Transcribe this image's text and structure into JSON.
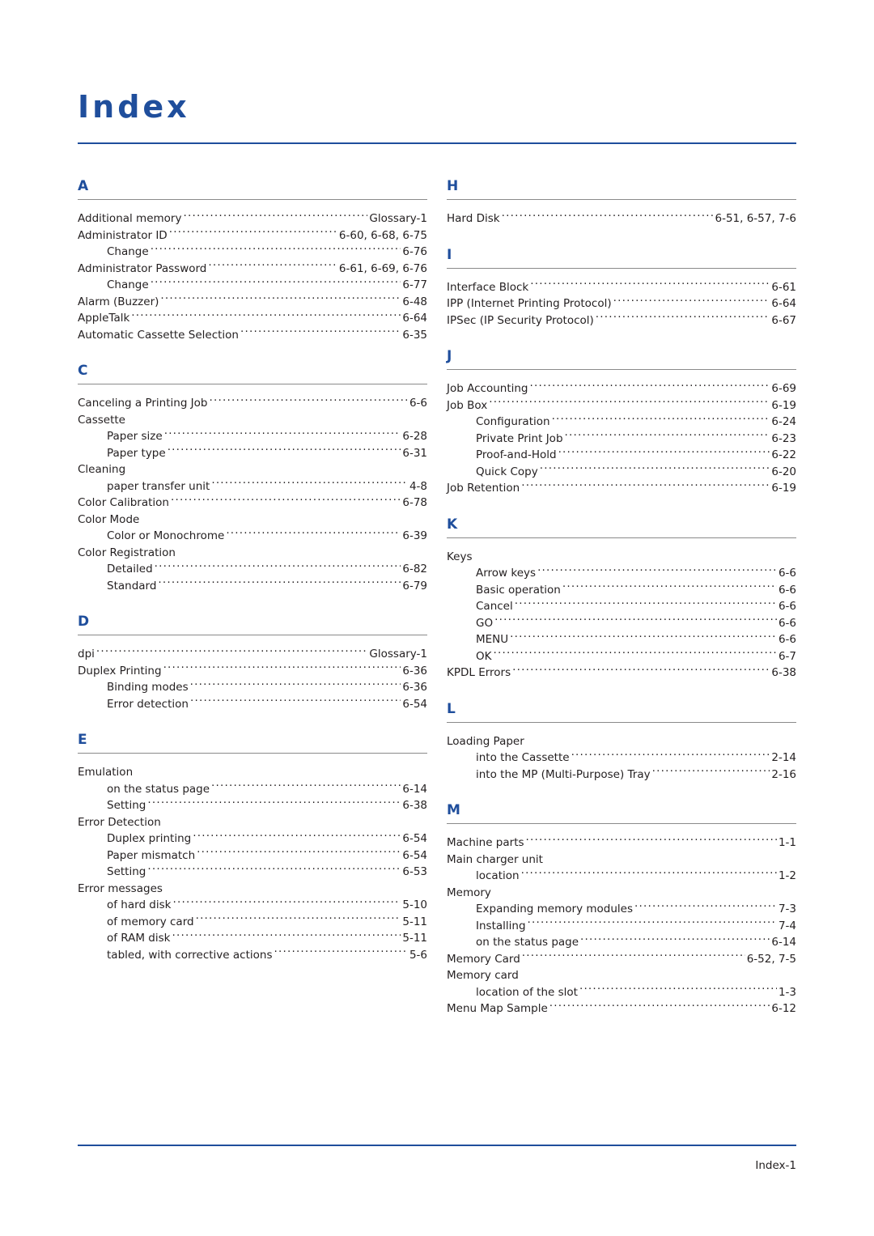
{
  "document": {
    "title": "Index",
    "footer": "Index-1"
  },
  "columns": [
    {
      "side": "left",
      "sections": [
        {
          "letter": "A",
          "entries": [
            {
              "label": "Additional memory",
              "page": "Glossary-1",
              "sub": false
            },
            {
              "label": "Administrator ID",
              "page": "6-60, 6-68, 6-75",
              "sub": false
            },
            {
              "label": "Change",
              "page": "6-76",
              "sub": true
            },
            {
              "label": "Administrator Password",
              "page": "6-61, 6-69, 6-76",
              "sub": false
            },
            {
              "label": "Change",
              "page": "6-77",
              "sub": true
            },
            {
              "label": "Alarm (Buzzer)",
              "page": "6-48",
              "sub": false
            },
            {
              "label": "AppleTalk",
              "page": "6-64",
              "sub": false
            },
            {
              "label": "Automatic Cassette Selection",
              "page": "6-35",
              "sub": false
            }
          ]
        },
        {
          "letter": "C",
          "entries": [
            {
              "label": "Canceling a Printing Job",
              "page": "6-6",
              "sub": false
            },
            {
              "label": "Cassette",
              "page": "",
              "sub": false
            },
            {
              "label": "Paper size",
              "page": "6-28",
              "sub": true
            },
            {
              "label": "Paper type",
              "page": "6-31",
              "sub": true
            },
            {
              "label": "Cleaning",
              "page": "",
              "sub": false
            },
            {
              "label": "paper transfer unit",
              "page": "4-8",
              "sub": true
            },
            {
              "label": "Color Calibration",
              "page": "6-78",
              "sub": false
            },
            {
              "label": "Color Mode",
              "page": "",
              "sub": false
            },
            {
              "label": "Color or Monochrome",
              "page": "6-39",
              "sub": true
            },
            {
              "label": "Color Registration",
              "page": "",
              "sub": false
            },
            {
              "label": "Detailed",
              "page": "6-82",
              "sub": true
            },
            {
              "label": "Standard",
              "page": "6-79",
              "sub": true
            }
          ]
        },
        {
          "letter": "D",
          "entries": [
            {
              "label": "dpi",
              "page": "Glossary-1",
              "sub": false
            },
            {
              "label": "Duplex Printing",
              "page": "6-36",
              "sub": false
            },
            {
              "label": "Binding modes",
              "page": "6-36",
              "sub": true
            },
            {
              "label": "Error detection",
              "page": "6-54",
              "sub": true
            }
          ]
        },
        {
          "letter": "E",
          "entries": [
            {
              "label": "Emulation",
              "page": "",
              "sub": false
            },
            {
              "label": "on the status page",
              "page": "6-14",
              "sub": true
            },
            {
              "label": "Setting",
              "page": "6-38",
              "sub": true
            },
            {
              "label": "Error Detection",
              "page": "",
              "sub": false
            },
            {
              "label": "Duplex printing",
              "page": "6-54",
              "sub": true
            },
            {
              "label": "Paper mismatch",
              "page": "6-54",
              "sub": true
            },
            {
              "label": "Setting",
              "page": "6-53",
              "sub": true
            },
            {
              "label": "Error messages",
              "page": "",
              "sub": false
            },
            {
              "label": "of hard disk",
              "page": "5-10",
              "sub": true
            },
            {
              "label": "of memory card",
              "page": "5-11",
              "sub": true
            },
            {
              "label": "of RAM disk",
              "page": "5-11",
              "sub": true
            },
            {
              "label": "tabled, with corrective actions",
              "page": "5-6",
              "sub": true
            }
          ]
        }
      ]
    },
    {
      "side": "right",
      "sections": [
        {
          "letter": "H",
          "entries": [
            {
              "label": "Hard Disk",
              "page": "6-51, 6-57, 7-6",
              "sub": false
            }
          ]
        },
        {
          "letter": "I",
          "entries": [
            {
              "label": "Interface Block",
              "page": "6-61",
              "sub": false
            },
            {
              "label": "IPP (Internet Printing Protocol)",
              "page": "6-64",
              "sub": false
            },
            {
              "label": "IPSec (IP Security Protocol)",
              "page": "6-67",
              "sub": false
            }
          ]
        },
        {
          "letter": "J",
          "entries": [
            {
              "label": "Job Accounting",
              "page": "6-69",
              "sub": false
            },
            {
              "label": "Job Box",
              "page": "6-19",
              "sub": false
            },
            {
              "label": "Configuration",
              "page": "6-24",
              "sub": true
            },
            {
              "label": "Private Print Job",
              "page": "6-23",
              "sub": true
            },
            {
              "label": "Proof-and-Hold",
              "page": "6-22",
              "sub": true
            },
            {
              "label": "Quick Copy",
              "page": "6-20",
              "sub": true
            },
            {
              "label": "Job Retention",
              "page": "6-19",
              "sub": false
            }
          ]
        },
        {
          "letter": "K",
          "entries": [
            {
              "label": "Keys",
              "page": "",
              "sub": false
            },
            {
              "label": "Arrow keys",
              "page": "6-6",
              "sub": true
            },
            {
              "label": "Basic operation",
              "page": "6-6",
              "sub": true
            },
            {
              "label": "Cancel",
              "page": "6-6",
              "sub": true
            },
            {
              "label": "GO",
              "page": "6-6",
              "sub": true
            },
            {
              "label": "MENU",
              "page": "6-6",
              "sub": true
            },
            {
              "label": "OK",
              "page": "6-7",
              "sub": true
            },
            {
              "label": "KPDL Errors",
              "page": "6-38",
              "sub": false
            }
          ]
        },
        {
          "letter": "L",
          "entries": [
            {
              "label": "Loading Paper",
              "page": "",
              "sub": false
            },
            {
              "label": "into the Cassette",
              "page": "2-14",
              "sub": true
            },
            {
              "label": "into the MP (Multi-Purpose) Tray",
              "page": "2-16",
              "sub": true
            }
          ]
        },
        {
          "letter": "M",
          "entries": [
            {
              "label": "Machine parts",
              "page": "1-1",
              "sub": false
            },
            {
              "label": "Main charger unit",
              "page": "",
              "sub": false
            },
            {
              "label": "location",
              "page": "1-2",
              "sub": true
            },
            {
              "label": "Memory",
              "page": "",
              "sub": false
            },
            {
              "label": "Expanding memory modules",
              "page": "7-3",
              "sub": true
            },
            {
              "label": "Installing",
              "page": "7-4",
              "sub": true
            },
            {
              "label": "on the status page",
              "page": "6-14",
              "sub": true
            },
            {
              "label": "Memory Card",
              "page": "6-52, 7-5",
              "sub": false
            },
            {
              "label": "Memory card",
              "page": "",
              "sub": false
            },
            {
              "label": "location of the slot",
              "page": "1-3",
              "sub": true
            },
            {
              "label": "Menu Map Sample",
              "page": "6-12",
              "sub": false
            }
          ]
        }
      ]
    }
  ]
}
